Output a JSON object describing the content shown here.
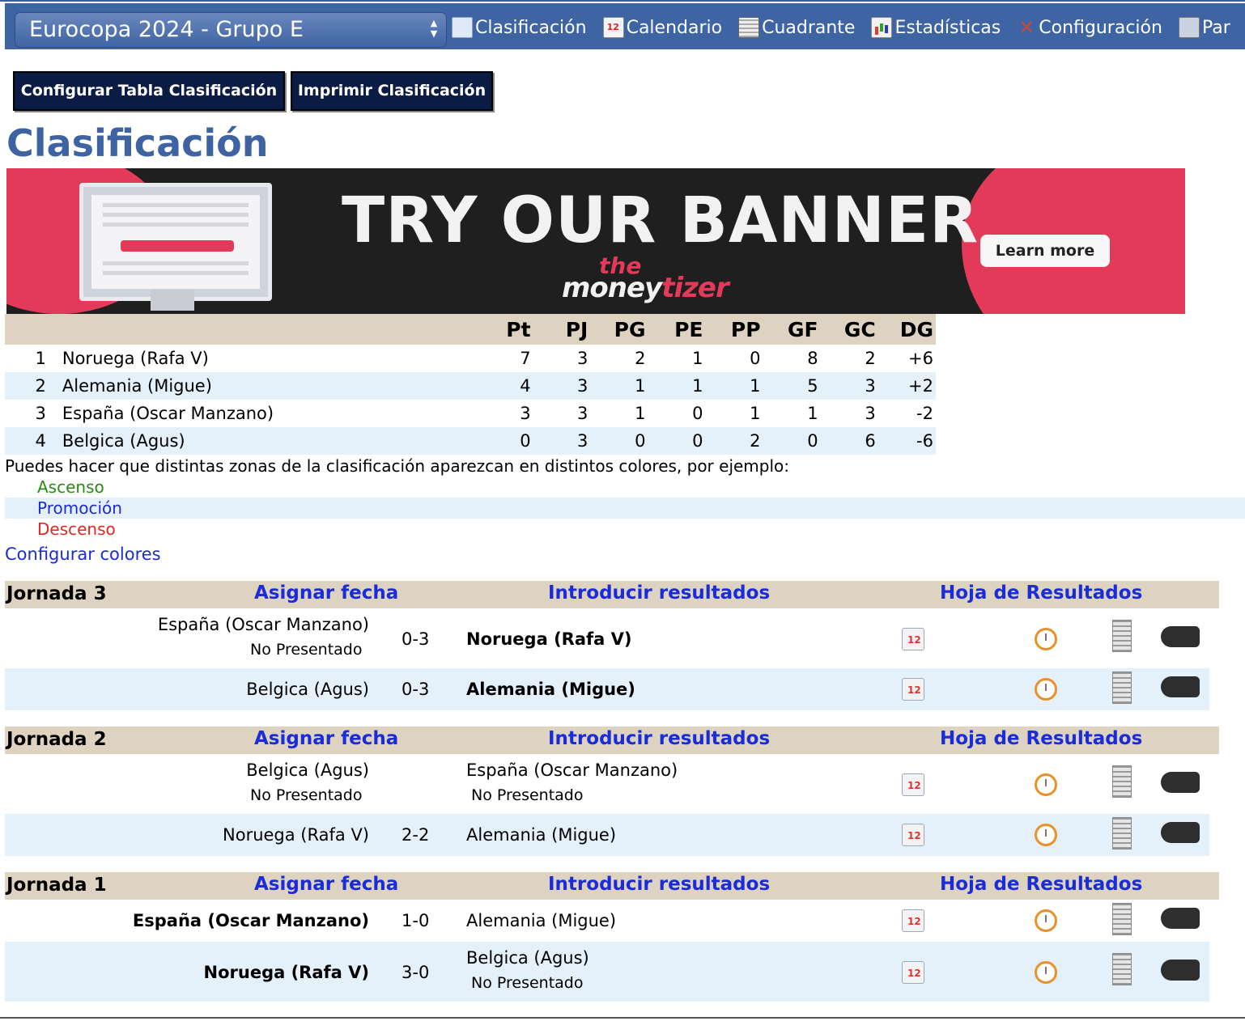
{
  "competition_select": {
    "value": "Eurocopa 2024 - Grupo E"
  },
  "nav": [
    {
      "label": "Clasificación",
      "icon": "calendar-grid-icon"
    },
    {
      "label": "Calendario",
      "icon": "calendar-12-icon"
    },
    {
      "label": "Cuadrante",
      "icon": "grid-table-icon"
    },
    {
      "label": "Estadísticas",
      "icon": "bar-chart-icon"
    },
    {
      "label": "Configuración",
      "icon": "tools-icon"
    },
    {
      "label": "Par",
      "icon": "players-icon"
    }
  ],
  "buttons": {
    "configure": "Configurar Tabla Clasificación",
    "print": "Imprimir Clasificación"
  },
  "page_title": "Clasificación",
  "banner": {
    "headline": "TRY OUR BANNER",
    "cta": "Learn more",
    "brand_top": "the",
    "brand_bottom_a": "money",
    "brand_bottom_b": "tizer"
  },
  "standings": {
    "columns": [
      "Pt",
      "PJ",
      "PG",
      "PE",
      "PP",
      "GF",
      "GC",
      "DG"
    ],
    "rows": [
      {
        "pos": "1",
        "team": "Noruega (Rafa V)",
        "pt": "7",
        "pj": "3",
        "pg": "2",
        "pe": "1",
        "pp": "0",
        "gf": "8",
        "gc": "2",
        "dg": "+6"
      },
      {
        "pos": "2",
        "team": "Alemania (Migue)",
        "pt": "4",
        "pj": "3",
        "pg": "1",
        "pe": "1",
        "pp": "1",
        "gf": "5",
        "gc": "3",
        "dg": "+2"
      },
      {
        "pos": "3",
        "team": "España (Oscar Manzano)",
        "pt": "3",
        "pj": "3",
        "pg": "1",
        "pe": "0",
        "pp": "1",
        "gf": "1",
        "gc": "3",
        "dg": "-2"
      },
      {
        "pos": "4",
        "team": "Belgica (Agus)",
        "pt": "0",
        "pj": "3",
        "pg": "0",
        "pe": "0",
        "pp": "2",
        "gf": "0",
        "gc": "6",
        "dg": "-6"
      }
    ]
  },
  "zones": {
    "hint": "Puedes hacer que distintas zonas de la clasificación aparezcan en distintos colores, por ejemplo:",
    "ascenso": "Ascenso",
    "promocion": "Promoción",
    "descenso": "Descenso",
    "configure_link": "Configurar colores",
    "colors": {
      "ascenso": "#2a8a16",
      "promocion": "#1a2bd8",
      "descenso": "#e0281f"
    }
  },
  "round_links": {
    "assign_date": "Asignar fecha",
    "enter_results": "Introducir resultados",
    "results_sheet": "Hoja de Resultados"
  },
  "rounds": [
    {
      "name": "Jornada 3",
      "matches": [
        {
          "home": "España (Oscar Manzano)",
          "home_note": "No Presentado",
          "score": "0-3",
          "away": "Noruega (Rafa V)",
          "away_note": ""
        },
        {
          "home": "Belgica (Agus)",
          "home_note": "",
          "score": "0-3",
          "away": "Alemania (Migue)",
          "away_note": ""
        }
      ]
    },
    {
      "name": "Jornada 2",
      "matches": [
        {
          "home": "Belgica (Agus)",
          "home_note": "No Presentado",
          "score": "",
          "away": "España (Oscar Manzano)",
          "away_note": "No Presentado"
        },
        {
          "home": "Noruega (Rafa V)",
          "home_note": "",
          "score": "2-2",
          "away": "Alemania (Migue)",
          "away_note": ""
        }
      ]
    },
    {
      "name": "Jornada 1",
      "matches": [
        {
          "home": "España (Oscar Manzano)",
          "home_note": "",
          "score": "1-0",
          "away": "Alemania (Migue)",
          "away_note": ""
        },
        {
          "home": "Noruega (Rafa V)",
          "home_note": "",
          "score": "3-0",
          "away": "Belgica (Agus)",
          "away_note": "No Presentado"
        }
      ]
    }
  ]
}
